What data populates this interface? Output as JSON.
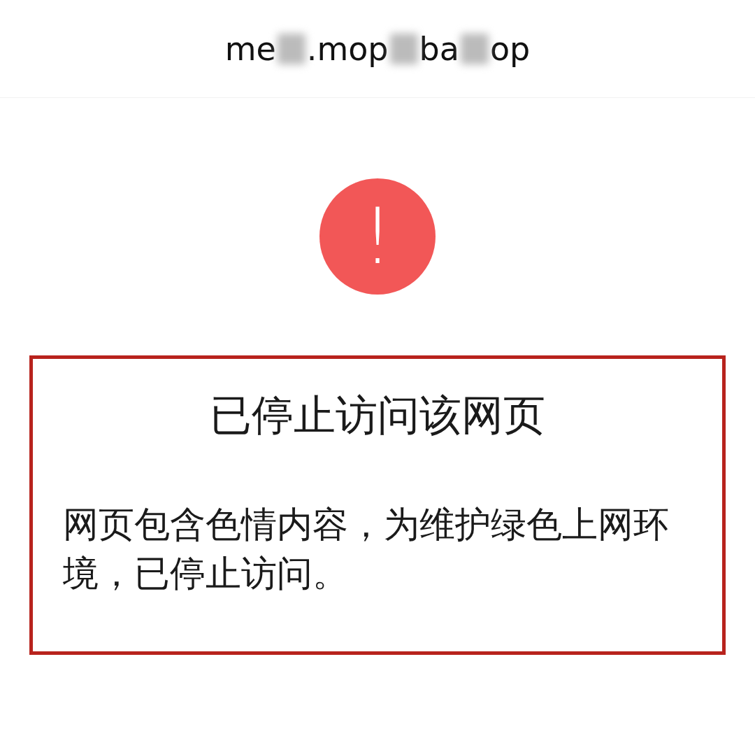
{
  "address_bar": {
    "fragments": [
      "me",
      ".mop",
      "ba",
      "op"
    ]
  },
  "error": {
    "icon": "!",
    "title": "已停止访问该网页",
    "message": "网页包含色情内容，为维护绿色上网环境，已停止访问。",
    "highlighted": true
  }
}
